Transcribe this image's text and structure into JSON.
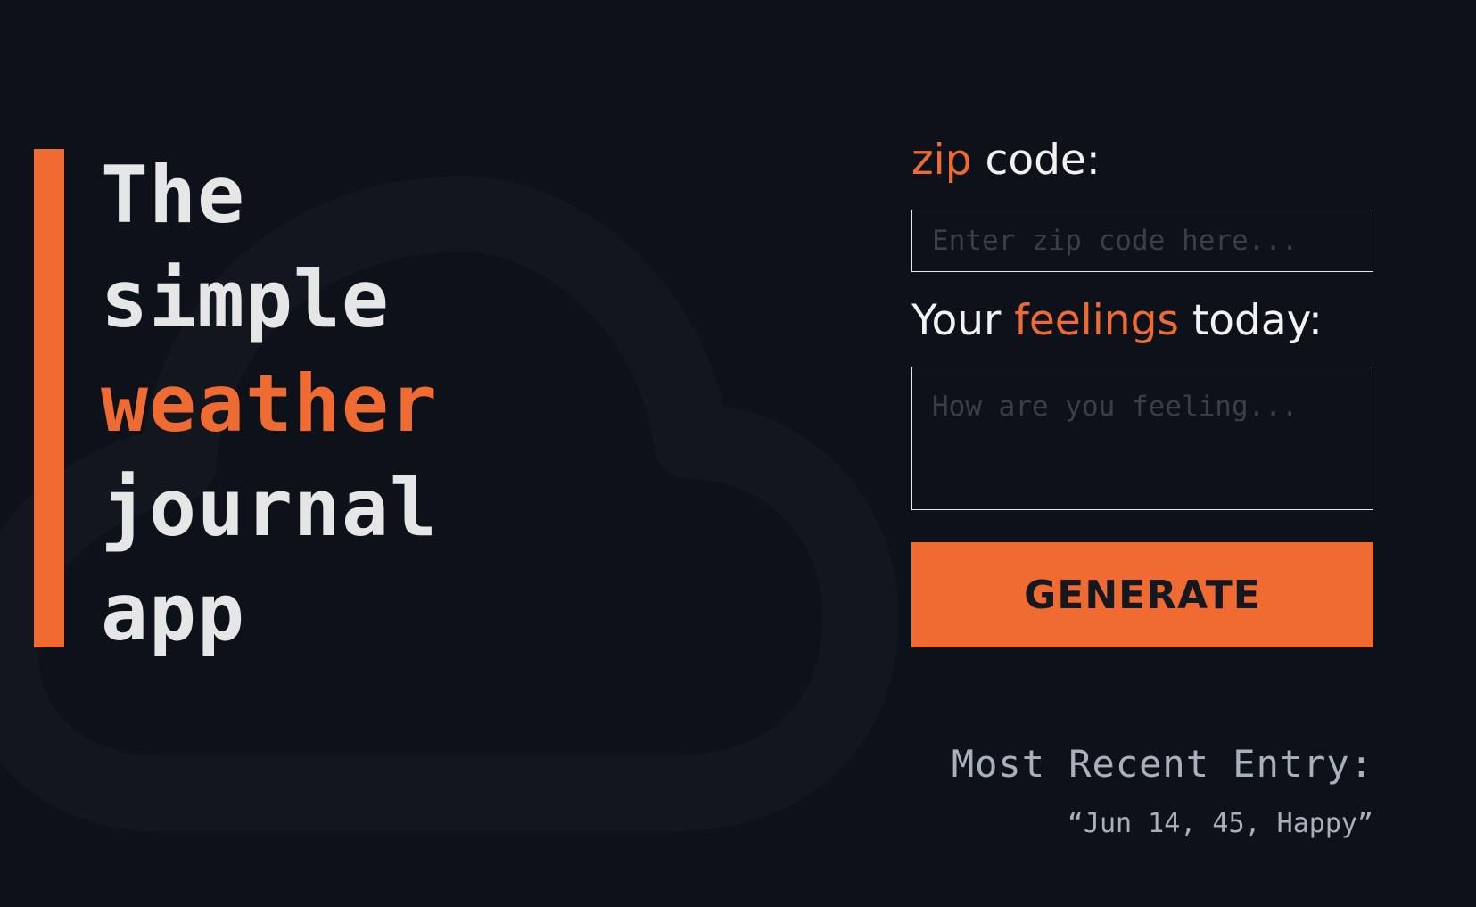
{
  "colors": {
    "background": "#0d121a",
    "accent": "#ef6b31",
    "text": "#e6e6e6",
    "muted": "#a9b0bb"
  },
  "background_icon": "cloud-icon",
  "headline": {
    "line1": "The",
    "line2": "simple",
    "line3": "weather",
    "line4": "journal",
    "line5": "app"
  },
  "form": {
    "zip_label_highlight": "zip",
    "zip_label_rest": " code:",
    "zip_placeholder": "Enter zip code here...",
    "feelings_label_start": "Your ",
    "feelings_label_highlight": "feelings",
    "feelings_label_end": " today:",
    "feelings_placeholder": "How are you feeling...",
    "generate_label": "GENERATE"
  },
  "recent": {
    "title": "Most Recent Entry:",
    "entry": "“Jun 14, 45, Happy”"
  }
}
